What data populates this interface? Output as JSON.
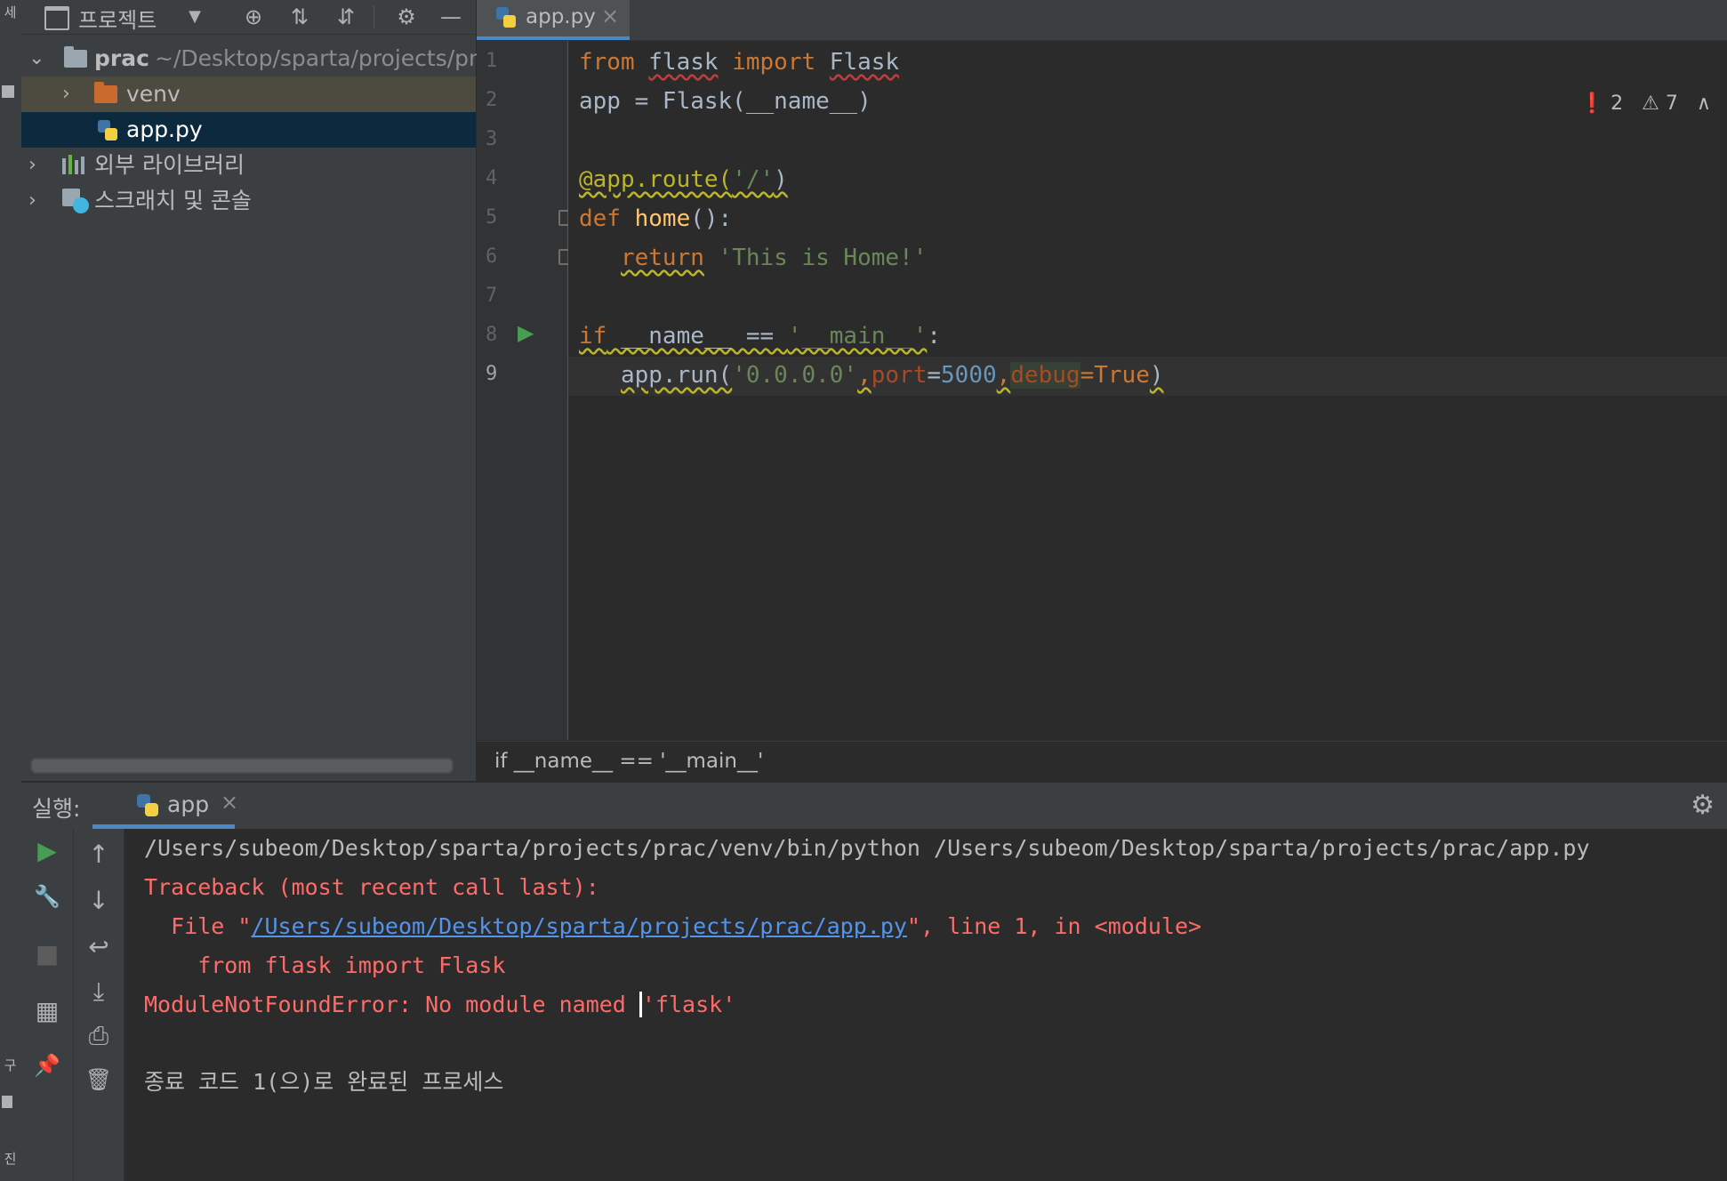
{
  "project_panel": {
    "title": "프로젝트",
    "tree": [
      {
        "label": "prac",
        "path": "~/Desktop/sparta/projects/pra"
      },
      {
        "label": "venv"
      },
      {
        "label": "app.py"
      },
      {
        "label": "외부 라이브러리"
      },
      {
        "label": "스크래치 및 콘솔"
      }
    ]
  },
  "editor": {
    "tab_label": "app.py",
    "line_numbers": [
      "1",
      "2",
      "3",
      "4",
      "5",
      "6",
      "7",
      "8",
      "9"
    ],
    "inspections": {
      "errors": "2",
      "warnings": "7"
    },
    "breadcrumb": "if __name__ == '__main__'",
    "code": {
      "l1": {
        "kw1": "from",
        "mod": "flask",
        "kw2": "import",
        "cls": "Flask"
      },
      "l2": {
        "lhs": "app = Flask(__name__)"
      },
      "l4": {
        "dec": "@app.route(",
        "arg": "'/'",
        "close": ")"
      },
      "l5": {
        "kw": "def",
        "name": "home",
        "rest": "():"
      },
      "l6": {
        "kw": "return",
        "str": "'This is Home!'"
      },
      "l8": {
        "kw": "if",
        "mid": " __name__ == ",
        "str": "'__main__'",
        "end": ":"
      },
      "l9": {
        "call": "app.run(",
        "host": "'0.0.0.0'",
        "comma1": ",",
        "port_kw": "port",
        "eq": "=",
        "port_val": "5000",
        "comma2": ",",
        "debug_kw": "debug",
        "eq2": "=True",
        "close": ")"
      }
    }
  },
  "run_panel": {
    "label": "실행:",
    "tab_label": "app",
    "console": {
      "cmd": "/Users/subeom/Desktop/sparta/projects/prac/venv/bin/python /Users/subeom/Desktop/sparta/projects/prac/app.py",
      "traceback": "Traceback (most recent call last):",
      "file_prefix": "  File \"",
      "file_link": "/Users/subeom/Desktop/sparta/projects/prac/app.py",
      "file_suffix": "\", line 1, in <module>",
      "source_line": "    from flask import Flask",
      "error_prefix": "ModuleNotFoundError: No module named ",
      "error_value": "'flask'",
      "exit": "종료 코드 1(으)로 완료된 프로세스"
    }
  },
  "icons": {
    "project-view-icon": "▭",
    "dropdown-icon": "▼",
    "locate-icon": "⊕",
    "expand-all-icon": "⇅",
    "collapse-all-icon": "⇵",
    "settings-icon": "⚙",
    "hide-icon": "—",
    "run-icon": "▶",
    "rerun-icon": "▶",
    "wrench-icon": "🔧",
    "stop-icon": "■",
    "layout-icon": "▦",
    "pin-icon": "📌",
    "up-icon": "↑",
    "down-icon": "↓",
    "soft-wrap-icon": "↩",
    "scroll-end-icon": "⤓",
    "print-icon": "⎙",
    "trash-icon": "🗑",
    "close-icon": "×",
    "error-icon": "❗",
    "warning-icon": "⚠",
    "chevron-up-icon": "∧"
  }
}
